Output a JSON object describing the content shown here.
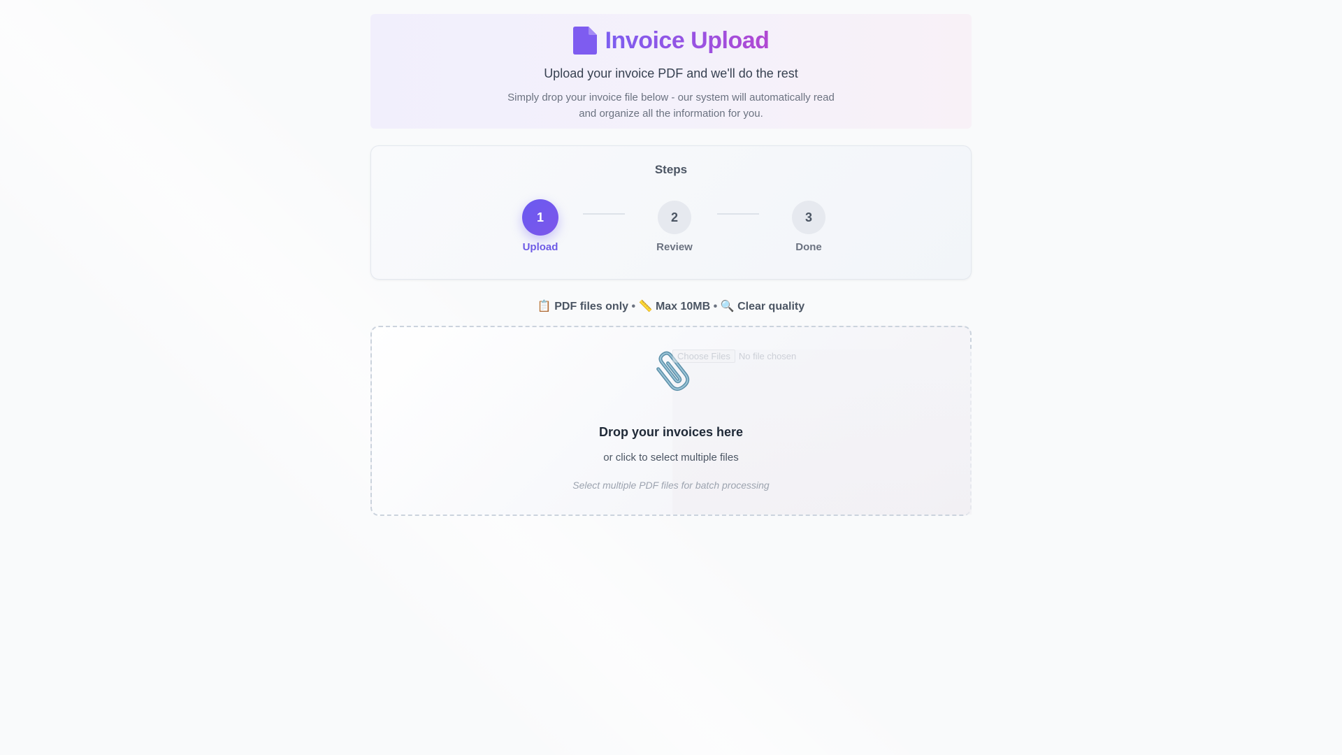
{
  "header": {
    "icon": "document-icon",
    "title": "Invoice Upload",
    "subtitle": "Upload your invoice PDF and we'll do the rest",
    "description": "Simply drop your invoice file below - our system will automatically read and organize all the information for you."
  },
  "steps": {
    "title": "Steps",
    "items": [
      {
        "number": "1",
        "label": "Upload",
        "active": true
      },
      {
        "number": "2",
        "label": "Review",
        "active": false
      },
      {
        "number": "3",
        "label": "Done",
        "active": false
      }
    ]
  },
  "requirements": {
    "items": [
      {
        "emoji": "📋",
        "text": "PDF files only"
      },
      {
        "emoji": "📏",
        "text": "Max 10MB"
      },
      {
        "emoji": "🔍",
        "text": "Clear quality"
      }
    ],
    "separator": "•"
  },
  "dropzone": {
    "icon": "paperclip-icon",
    "file_button": "Choose Files",
    "file_status": "No file chosen",
    "title": "Drop your invoices here",
    "subtitle": "or click to select multiple files",
    "hint": "Select multiple PDF files for batch processing"
  },
  "colors": {
    "accent": "#6c5ce7",
    "title_gradient_start": "#7c5ef0",
    "title_gradient_end": "#b148d2"
  }
}
